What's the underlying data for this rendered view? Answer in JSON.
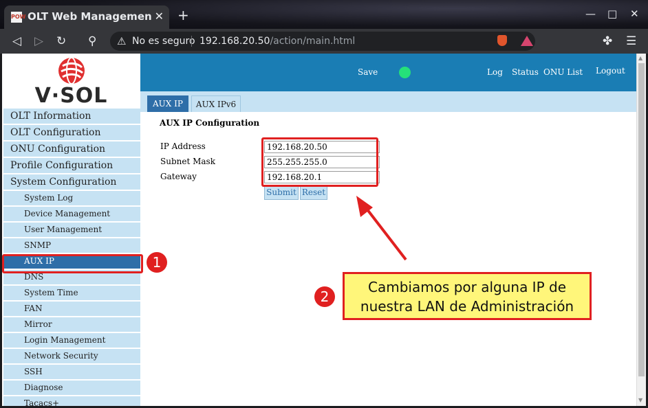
{
  "browser": {
    "tab_title": "OLT Web Management Int",
    "favicon_text": "POW",
    "new_tab_symbol": "+",
    "security_text": "No es seguro",
    "url_host": "192.168.20.50",
    "url_path": "/action/main.html"
  },
  "logo": {
    "text": "V·SOL"
  },
  "menu": {
    "top_items": [
      "OLT Information",
      "OLT Configuration",
      "ONU Configuration",
      "Profile Configuration",
      "System Configuration"
    ],
    "sub_items": [
      "System Log",
      "Device Management",
      "User Management",
      "SNMP",
      "AUX IP",
      "DNS",
      "System Time",
      "FAN",
      "Mirror",
      "Login Management",
      "Network Security",
      "SSH",
      "Diagnose",
      "Tacacs+"
    ],
    "active_sub": "AUX IP"
  },
  "header": {
    "save_label": "Save",
    "status_color": "#25e07a",
    "log_label": "Log",
    "status_label": "Status",
    "onu_list_label": "ONU List",
    "logout_label": "Logout"
  },
  "tabs": [
    {
      "label": "AUX IP",
      "active": true
    },
    {
      "label": "AUX IPv6",
      "active": false
    }
  ],
  "form": {
    "title": "AUX IP Configuration",
    "ip_label": "IP Address",
    "ip_value": "192.168.20.50",
    "mask_label": "Subnet Mask",
    "mask_value": "255.255.255.0",
    "gateway_label": "Gateway",
    "gateway_value": "192.168.20.1",
    "submit_label": "Submit",
    "reset_label": "Reset"
  },
  "annotations": {
    "badge1": "1",
    "badge2": "2",
    "callout_line1": "Cambiamos por alguna IP de",
    "callout_line2": "nuestra LAN de Administración",
    "highlight_color": "#e02020",
    "callout_color": "#fff67a"
  },
  "colors": {
    "header_blue": "#1a7db4",
    "menu_bg": "#c6e2f3",
    "active_blue": "#2e6ea8"
  }
}
